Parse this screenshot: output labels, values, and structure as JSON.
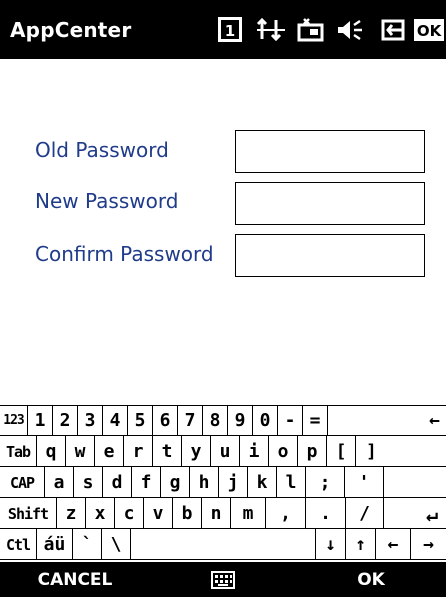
{
  "titlebar": {
    "app_title": "AppCenter",
    "status_icons": [
      "sim-slot-1-icon",
      "connectivity-icon",
      "battery-icon",
      "speaker-icon",
      "power-plug-icon",
      "ok-icon"
    ],
    "ok_label": "OK",
    "slot_label": "1"
  },
  "form": {
    "old_password_label": "Old Password",
    "new_password_label": "New Password",
    "confirm_password_label": "Confirm Password",
    "old_password_value": "",
    "new_password_value": "",
    "confirm_password_value": ""
  },
  "keyboard": {
    "row1": [
      "123",
      "1",
      "2",
      "3",
      "4",
      "5",
      "6",
      "7",
      "8",
      "9",
      "0",
      "-",
      "=",
      "←"
    ],
    "row2": [
      "Tab",
      "q",
      "w",
      "e",
      "r",
      "t",
      "y",
      "u",
      "i",
      "o",
      "p",
      "[",
      "]"
    ],
    "row3": [
      "CAP",
      "a",
      "s",
      "d",
      "f",
      "g",
      "h",
      "j",
      "k",
      "l",
      ";",
      "'"
    ],
    "row4": [
      "Shift",
      "z",
      "x",
      "c",
      "v",
      "b",
      "n",
      "m",
      ",",
      ".",
      "/",
      "↵"
    ],
    "row5": [
      "Ctl",
      "áü",
      "`",
      "\\",
      "",
      "↓",
      "↑",
      "←",
      "→"
    ]
  },
  "cmdbar": {
    "left_label": "CANCEL",
    "center_icon": "keyboard-icon",
    "right_label": "OK"
  },
  "colors": {
    "label_color": "#1f3b8a",
    "bar_background": "#000000"
  }
}
